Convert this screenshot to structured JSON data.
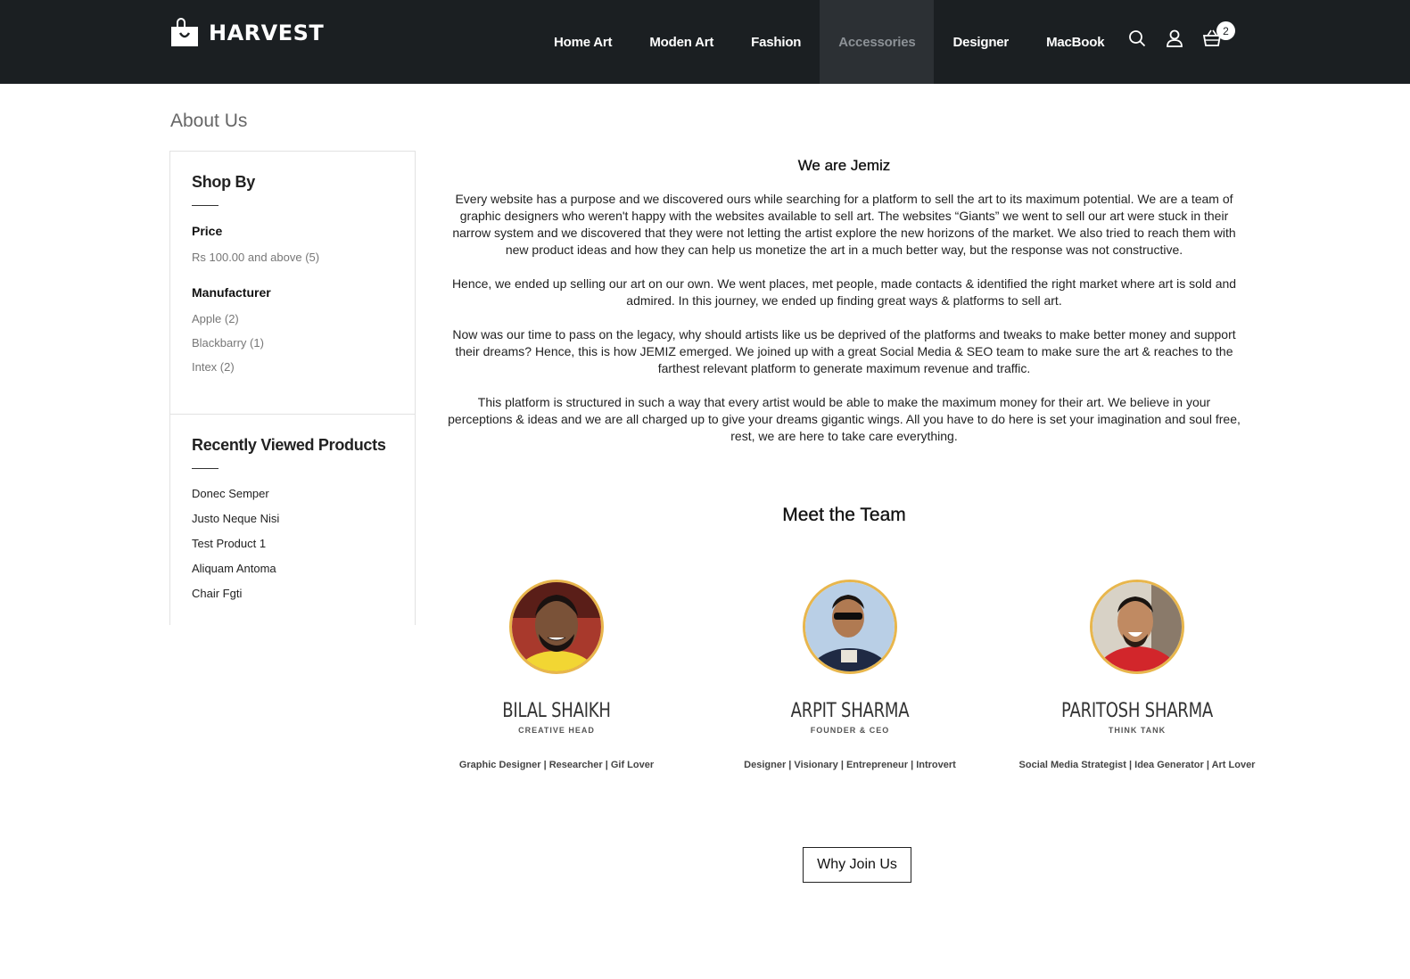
{
  "header": {
    "logo_text": "HARVEST",
    "nav": [
      {
        "label": "Home Art"
      },
      {
        "label": "Moden Art"
      },
      {
        "label": "Fashion"
      },
      {
        "label": "Accessories"
      },
      {
        "label": "Designer"
      },
      {
        "label": "MacBook"
      }
    ],
    "active_nav": "Accessories",
    "icons": [
      "search-icon",
      "user-icon",
      "cart-icon"
    ],
    "cart_count": "2"
  },
  "page": {
    "title": "About Us"
  },
  "sidebar": {
    "shop_by_title": "Shop By",
    "price_title": "Price",
    "price_items": [
      "Rs 100.00 and above (5)"
    ],
    "manufacturer_title": "Manufacturer",
    "manufacturer_items": [
      "Apple (2)",
      "Blackbarry (1)",
      "Intex (2)"
    ],
    "recent_title": "Recently Viewed Products",
    "recent_items": [
      "Donec Semper",
      "Justo Neque Nisi",
      "Test Product 1",
      "Aliquam Antoma",
      "Chair Fgti"
    ]
  },
  "about": {
    "heading": "We are Jemiz",
    "paragraphs": [
      "Every website has a purpose and we discovered ours while searching for a platform to sell the art to its maximum potential. We are a team of graphic designers who weren't happy with the websites available to sell art. The websites “Giants” we went to sell our art were stuck in their narrow system and we discovered that they were not letting the artist explore the new horizons of the market. We also tried to reach them with new product ideas and how they can help us monetize the art in a much better way, but the response was not constructive.",
      "Hence, we ended up selling our art on our own. We went places, met people, made contacts & identified the right market where art is sold and admired. In this journey, we ended up finding great ways & platforms to sell art.",
      "Now was our time to pass on the legacy, why should artists like us be deprived of the platforms and tweaks to make better money and support their dreams? Hence, this is how JEMIZ emerged. We joined up with a great Social Media & SEO team to make sure the art & reaches to the farthest relevant platform to generate maximum revenue and traffic.",
      "This platform is structured in such a way that every artist would be able to make the maximum money for their art. We believe in your perceptions & ideas and we are all charged up to give your dreams gigantic wings. All you have to do here is set your imagination and soul free, rest, we are here to take care everything."
    ]
  },
  "team": {
    "title": "Meet the Team",
    "members": [
      {
        "name": "BILAL SHAIKH",
        "role": "CREATIVE HEAD",
        "traits": "Graphic Designer | Researcher | Gif Lover"
      },
      {
        "name": "ARPIT SHARMA",
        "role": "FOUNDER & CEO",
        "traits": "Designer | Visionary | Entrepreneur | Introvert"
      },
      {
        "name": "PARITOSH SHARMA",
        "role": "THINK TANK",
        "traits": "Social Media Strategist | Idea Generator | Art Lover"
      }
    ]
  },
  "cta": {
    "label": "Why Join Us"
  },
  "colors": {
    "header_bg": "#1b1f22",
    "nav_active_bg": "#2c3034",
    "avatar_ring": "#e8b64c"
  }
}
